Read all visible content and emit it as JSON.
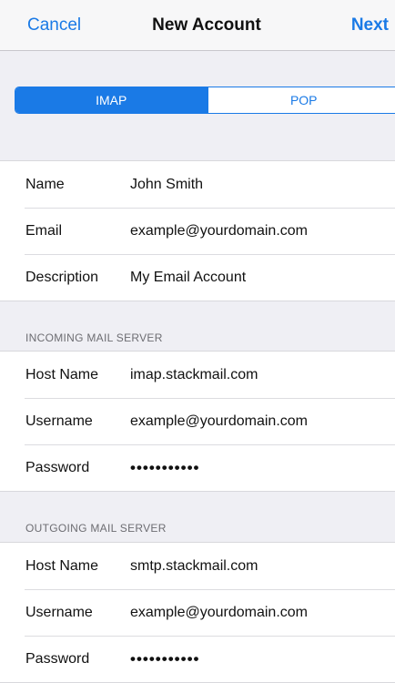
{
  "nav": {
    "cancel_label": "Cancel",
    "title": "New Account",
    "next_label": "Next"
  },
  "segments": {
    "imap_label": "IMAP",
    "pop_label": "POP",
    "selected": "IMAP"
  },
  "account": {
    "name_label": "Name",
    "name_value": "John Smith",
    "email_label": "Email",
    "email_value": "example@yourdomain.com",
    "description_label": "Description",
    "description_value": "My Email Account"
  },
  "incoming": {
    "header": "INCOMING MAIL SERVER",
    "host_label": "Host Name",
    "host_value": "imap.stackmail.com",
    "username_label": "Username",
    "username_value": "example@yourdomain.com",
    "password_label": "Password",
    "password_value": "•••••••••••"
  },
  "outgoing": {
    "header": "OUTGOING MAIL SERVER",
    "host_label": "Host Name",
    "host_value": "smtp.stackmail.com",
    "username_label": "Username",
    "username_value": "example@yourdomain.com",
    "password_label": "Password",
    "password_value": "•••••••••••"
  },
  "colors": {
    "accent": "#1a7ae6",
    "background": "#efeff4"
  }
}
